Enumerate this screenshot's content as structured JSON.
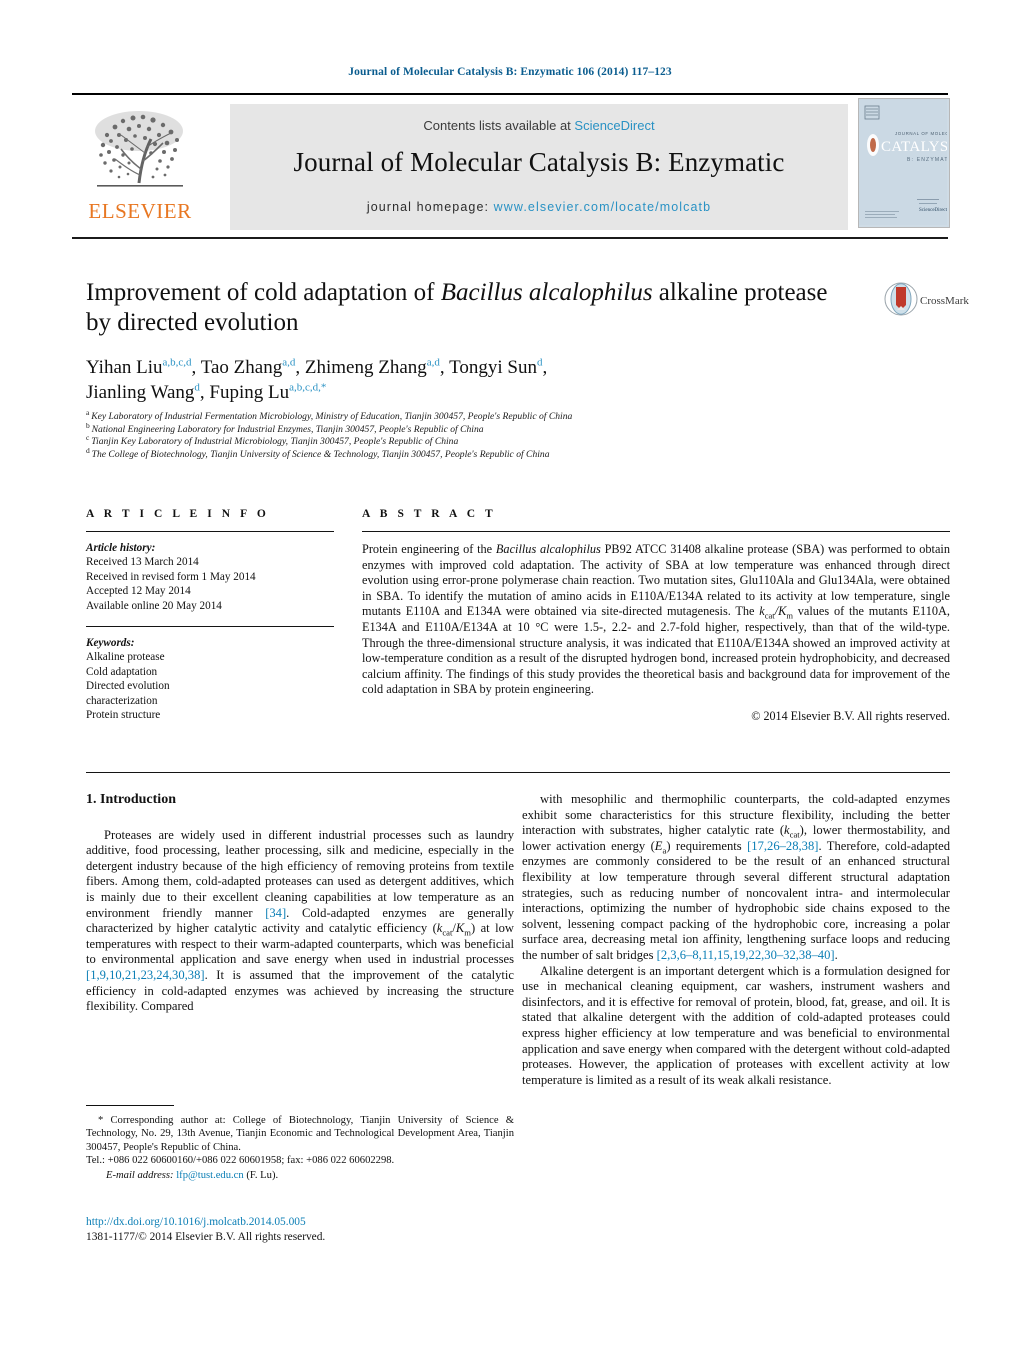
{
  "running_head": "Journal of Molecular Catalysis B: Enzymatic 106 (2014) 117–123",
  "masthead": {
    "publisher": "ELSEVIER",
    "contents_prefix": "Contents lists available at ",
    "contents_link": "ScienceDirect",
    "journal_title": "Journal of Molecular Catalysis B: Enzymatic",
    "homepage_prefix": "journal homepage: ",
    "homepage_url": "www.elsevier.com/locate/molcatb",
    "cover_title_lines": [
      "JOURNAL OF MOLECULAR",
      "CATALYSIS",
      "B: ENZYMATIC"
    ],
    "link_color": "#2a92c4",
    "band_color": "#e6e6e6",
    "publisher_color": "#e87722"
  },
  "article": {
    "title_part1": "Improvement of cold adaptation of ",
    "title_italic": "Bacillus alcalophilus",
    "title_part2": " alkaline protease by directed evolution",
    "crossmark_label": "CrossMark",
    "authors": [
      {
        "name": "Yihan Liu",
        "sup": "a,b,c,d",
        "sep": ", "
      },
      {
        "name": "Tao Zhang",
        "sup": "a,d",
        "sep": ", "
      },
      {
        "name": "Zhimeng Zhang",
        "sup": "a,d",
        "sep": ", "
      },
      {
        "name": "Tongyi Sun",
        "sup": "d",
        "sep": ","
      },
      {
        "name": "Jianling Wang",
        "sup": "d",
        "sep": ", "
      },
      {
        "name": "Fuping Lu",
        "sup": "a,b,c,d,*",
        "sep": ""
      }
    ],
    "affiliations": [
      {
        "mark": "a",
        "text": "Key Laboratory of Industrial Fermentation Microbiology, Ministry of Education, Tianjin 300457, People's Republic of China"
      },
      {
        "mark": "b",
        "text": "National Engineering Laboratory for Industrial Enzymes, Tianjin 300457, People's Republic of China"
      },
      {
        "mark": "c",
        "text": "Tianjin Key Laboratory of Industrial Microbiology, Tianjin 300457, People's Republic of China"
      },
      {
        "mark": "d",
        "text": "The College of Biotechnology, Tianjin University of Science & Technology, Tianjin 300457, People's Republic of China"
      }
    ]
  },
  "article_info": {
    "heading": "A R T I C L E   I N F O",
    "history_label": "Article history:",
    "history": [
      "Received 13 March 2014",
      "Received in revised form 1 May 2014",
      "Accepted 12 May 2014",
      "Available online 20 May 2014"
    ],
    "keywords_label": "Keywords:",
    "keywords": [
      "Alkaline protease",
      "Cold adaptation",
      "Directed evolution",
      "characterization",
      "Protein structure"
    ]
  },
  "abstract": {
    "heading": "A B S T R A C T",
    "copyright": "© 2014 Elsevier B.V. All rights reserved.",
    "paragraph_segments": [
      {
        "t": "Protein engineering of the "
      },
      {
        "t": "Bacillus alcalophilus",
        "style": "i"
      },
      {
        "t": " PB92 ATCC 31408 alkaline protease (SBA) was performed to obtain enzymes with improved cold adaptation. The activity of SBA at low temperature was enhanced through direct evolution using error-prone polymerase chain reaction. Two mutation sites, Glu110Ala and Glu134Ala, were obtained in SBA. To identify the mutation of amino acids in E110A/E134A related to its activity at low temperature, single mutants E110A and E134A were obtained via site-directed mutagenesis. The "
      },
      {
        "t": "k",
        "style": "i"
      },
      {
        "t": "cat",
        "style": "sub"
      },
      {
        "t": "/",
        "style": "i"
      },
      {
        "t": "K",
        "style": "i"
      },
      {
        "t": "m",
        "style": "sub"
      },
      {
        "t": " values of the mutants E110A, E134A and E110A/E134A at 10 °C were 1.5-, 2.2- and 2.7-fold higher, respectively, than that of the wild-type. Through the three-dimensional structure analysis, it was indicated that E110A/E134A showed an improved activity at low-temperature condition as a result of the disrupted hydrogen bond, increased protein hydrophobicity, and decreased calcium affinity. The findings of this study provides the theoretical basis and background data for improvement of the cold adaptation in SBA by protein engineering."
      }
    ]
  },
  "introduction": {
    "number_title": "1.  Introduction",
    "left_paragraph": [
      {
        "t": "Proteases are widely used in different industrial processes such as laundry additive, food processing, leather processing, silk and medicine, especially in the detergent industry because of the high efficiency of removing proteins from textile fibers. Among them, cold-adapted proteases can used as detergent additives, which is mainly due to their excellent cleaning capabilities at low temperature as an environment friendly manner "
      },
      {
        "t": "[34]",
        "style": "ref"
      },
      {
        "t": ". Cold-adapted enzymes are generally characterized by higher catalytic activity and catalytic efficiency ("
      },
      {
        "t": "k",
        "style": "i"
      },
      {
        "t": "cat",
        "style": "sub"
      },
      {
        "t": "/"
      },
      {
        "t": "K",
        "style": "i"
      },
      {
        "t": "m",
        "style": "sub"
      },
      {
        "t": ") at low temperatures with respect to their warm-adapted counterparts, which was beneficial to environmental application and save energy when used in industrial processes "
      },
      {
        "t": "[1,9,10,21,23,24,30,38]",
        "style": "ref"
      },
      {
        "t": ". It is assumed that the improvement of the catalytic efficiency in cold-adapted enzymes was achieved by increasing the structure flexibility. Compared"
      }
    ],
    "right_paragraph_1": [
      {
        "t": "with mesophilic and thermophilic counterparts, the cold-adapted enzymes exhibit some characteristics for this structure flexibility, including the better interaction with substrates, higher catalytic rate ("
      },
      {
        "t": "k",
        "style": "i"
      },
      {
        "t": "cat",
        "style": "sub"
      },
      {
        "t": "), lower thermostability, and lower activation energy ("
      },
      {
        "t": "E",
        "style": "i"
      },
      {
        "t": "a",
        "style": "sub"
      },
      {
        "t": ") requirements "
      },
      {
        "t": "[17,26–28,38]",
        "style": "ref"
      },
      {
        "t": ". Therefore, cold-adapted enzymes are commonly considered to be the result of an enhanced structural flexibility at low temperature through several different structural adaptation strategies, such as reducing number of noncovalent intra- and intermolecular interactions, optimizing the number of hydrophobic side chains exposed to the solvent, lessening compact packing of the hydrophobic core, increasing a polar surface area, decreasing metal ion affinity, lengthening surface loops and reducing the number of salt bridges "
      },
      {
        "t": "[2,3,6–8,11,15,19,22,30–32,38–40]",
        "style": "ref"
      },
      {
        "t": "."
      }
    ],
    "right_paragraph_2": [
      {
        "t": "Alkaline detergent is an important detergent which is a formulation designed for use in mechanical cleaning equipment, car washers, instrument washers and disinfectors, and it is effective for removal of protein, blood, fat, grease, and oil. It is stated that alkaline detergent with the addition of cold-adapted proteases could express higher efficiency at low temperature and was beneficial to environmental application and save energy when compared with the detergent without cold-adapted proteases. However, the application of proteases with excellent activity at low temperature is limited as a result of its weak alkali resistance."
      }
    ]
  },
  "footnote": {
    "corresponding": "* Corresponding author at: College of Biotechnology, Tianjin University of Science & Technology, No. 29, 13th Avenue, Tianjin Economic and Technological Development Area, Tianjin 300457, People's Republic of China.",
    "tel": "Tel.: +086 022 60600160/+086 022 60601958; fax: +086 022 60602298.",
    "email_label": "E-mail address:",
    "email": "lfp@tust.edu.cn",
    "email_owner": "(F. Lu).",
    "doi": "http://dx.doi.org/10.1016/j.molcatb.2014.05.005",
    "issn": "1381-1177/© 2014 Elsevier B.V. All rights reserved."
  }
}
